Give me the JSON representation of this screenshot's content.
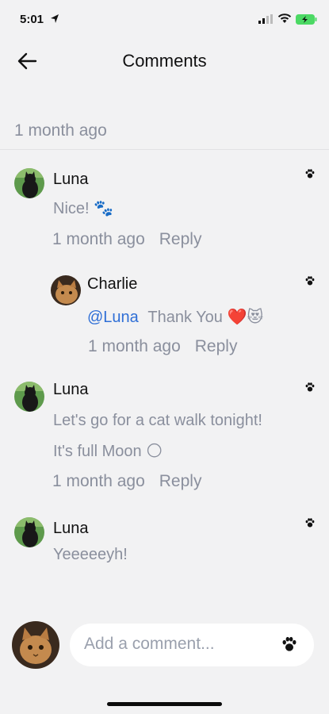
{
  "status_bar": {
    "time": "5:01"
  },
  "header": {
    "title": "Comments"
  },
  "post": {
    "time_ago": "1 month ago"
  },
  "comments": [
    {
      "author": "Luna",
      "lines": [
        "Nice! 🐾"
      ],
      "time_ago": "1 month ago",
      "reply_label": "Reply"
    },
    {
      "author": "Charlie",
      "mention": "@Luna",
      "lines": [
        "Thank You ❤️😻"
      ],
      "time_ago": "1 month ago",
      "reply_label": "Reply"
    },
    {
      "author": "Luna",
      "lines": [
        "Let's go for a cat walk tonight!",
        "It's full Moon 🌕"
      ],
      "time_ago": "1 month ago",
      "reply_label": "Reply"
    },
    {
      "author": "Luna",
      "lines": [
        "Yeeeeeyh!"
      ]
    }
  ],
  "composer": {
    "placeholder": "Add a comment..."
  }
}
